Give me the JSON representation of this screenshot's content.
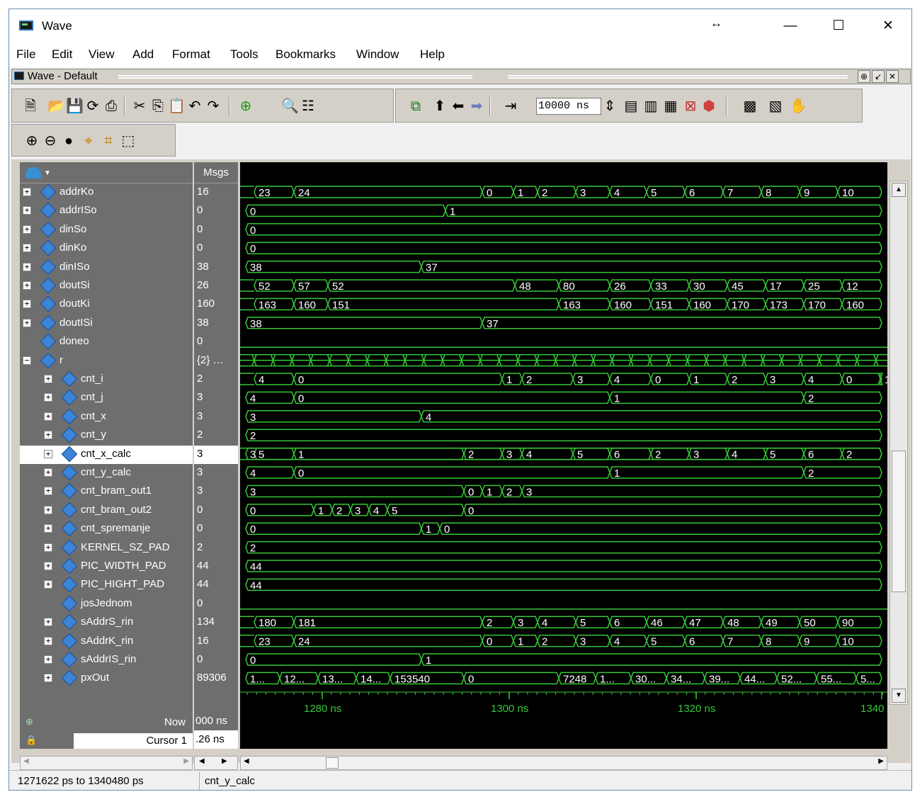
{
  "window": {
    "title": "Wave",
    "resize_indicator": "↔",
    "minimize": "—",
    "maximize": "☐",
    "close": "✕"
  },
  "menu": [
    "File",
    "Edit",
    "View",
    "Add",
    "Format",
    "Tools",
    "Bookmarks",
    "Window",
    "Help"
  ],
  "subwindow": {
    "title": "Wave - Default"
  },
  "toolbar": {
    "time_value": "10000 ns"
  },
  "columns": {
    "msgs": "Msgs"
  },
  "signals": [
    {
      "name": "addrKo",
      "value": "16",
      "level": 0,
      "expand": "+",
      "wave": [
        "23",
        "24",
        "0",
        "1",
        "2",
        "3",
        "4",
        "5",
        "6",
        "7",
        "8",
        "9",
        "10"
      ]
    },
    {
      "name": "addrISo",
      "value": "0",
      "level": 0,
      "expand": "+",
      "wave": [
        "0",
        "1"
      ]
    },
    {
      "name": "dinSo",
      "value": "0",
      "level": 0,
      "expand": "+",
      "wave": [
        "0"
      ]
    },
    {
      "name": "dinKo",
      "value": "0",
      "level": 0,
      "expand": "+",
      "wave": [
        "0"
      ]
    },
    {
      "name": "dinISo",
      "value": "38",
      "level": 0,
      "expand": "+",
      "wave": [
        "38",
        "37"
      ]
    },
    {
      "name": "doutSi",
      "value": "26",
      "level": 0,
      "expand": "+",
      "wave": [
        "52",
        "57",
        "52",
        "48",
        "80",
        "26",
        "33",
        "30",
        "45",
        "17",
        "25",
        "12"
      ]
    },
    {
      "name": "doutKi",
      "value": "160",
      "level": 0,
      "expand": "+",
      "wave": [
        "163",
        "160",
        "151",
        "163",
        "160",
        "151",
        "160",
        "170",
        "173",
        "170",
        "160"
      ]
    },
    {
      "name": "doutISi",
      "value": "38",
      "level": 0,
      "expand": "+",
      "wave": [
        "38",
        "37"
      ]
    },
    {
      "name": "doneo",
      "value": "0",
      "level": 0,
      "expand": "",
      "wave": []
    },
    {
      "name": "r",
      "value": "{2} …",
      "level": 0,
      "expand": "−",
      "wave": []
    },
    {
      "name": "cnt_i",
      "value": "2",
      "level": 1,
      "expand": "+",
      "wave": [
        "4",
        "0",
        "1",
        "2",
        "3",
        "4",
        "0",
        "1",
        "2",
        "3",
        "4",
        "0",
        "1"
      ]
    },
    {
      "name": "cnt_j",
      "value": "3",
      "level": 1,
      "expand": "+",
      "wave": [
        "4",
        "0",
        "1",
        "2"
      ]
    },
    {
      "name": "cnt_x",
      "value": "3",
      "level": 1,
      "expand": "+",
      "wave": [
        "3",
        "4"
      ]
    },
    {
      "name": "cnt_y",
      "value": "2",
      "level": 1,
      "expand": "+",
      "wave": [
        "2"
      ]
    },
    {
      "name": "cnt_x_calc",
      "value": "3",
      "level": 1,
      "expand": "+",
      "selected": true,
      "wave": [
        "5",
        "1",
        "2",
        "3",
        "4",
        "5",
        "6",
        "2",
        "3",
        "4",
        "5",
        "6",
        "2",
        "3"
      ]
    },
    {
      "name": "cnt_y_calc",
      "value": "3",
      "level": 1,
      "expand": "+",
      "wave": [
        "4",
        "0",
        "1",
        "2"
      ]
    },
    {
      "name": "cnt_bram_out1",
      "value": "3",
      "level": 1,
      "expand": "+",
      "wave": [
        "3",
        "0",
        "1",
        "2",
        "3"
      ]
    },
    {
      "name": "cnt_bram_out2",
      "value": "0",
      "level": 1,
      "expand": "+",
      "wave": [
        "0",
        "1",
        "2",
        "3",
        "4",
        "5",
        "0"
      ]
    },
    {
      "name": "cnt_spremanje",
      "value": "0",
      "level": 1,
      "expand": "+",
      "wave": [
        "0",
        "1",
        "0"
      ]
    },
    {
      "name": "KERNEL_SZ_PAD",
      "value": "2",
      "level": 1,
      "expand": "+",
      "wave": [
        "2"
      ]
    },
    {
      "name": "PIC_WIDTH_PAD",
      "value": "44",
      "level": 1,
      "expand": "+",
      "wave": [
        "44"
      ]
    },
    {
      "name": "PIC_HIGHT_PAD",
      "value": "44",
      "level": 1,
      "expand": "+",
      "wave": [
        "44"
      ]
    },
    {
      "name": "josJednom",
      "value": "0",
      "level": 1,
      "expand": "",
      "wave": []
    },
    {
      "name": "sAddrS_rin",
      "value": "134",
      "level": 1,
      "expand": "+",
      "wave": [
        "180",
        "181",
        "2",
        "3",
        "4",
        "5",
        "6",
        "46",
        "47",
        "48",
        "49",
        "50",
        "90"
      ]
    },
    {
      "name": "sAddrK_rin",
      "value": "16",
      "level": 1,
      "expand": "+",
      "wave": [
        "23",
        "24",
        "0",
        "1",
        "2",
        "3",
        "4",
        "5",
        "6",
        "7",
        "8",
        "9",
        "10"
      ]
    },
    {
      "name": "sAddrIS_rin",
      "value": "0",
      "level": 1,
      "expand": "+",
      "wave": [
        "0",
        "1"
      ]
    },
    {
      "name": "pxOut",
      "value": "89306",
      "level": 1,
      "expand": "+",
      "wave": [
        "1...",
        "12...",
        "13...",
        "14...",
        "153540",
        "0",
        "7248",
        "1...",
        "30...",
        "34...",
        "39...",
        "44...",
        "52...",
        "55...",
        "5..."
      ]
    }
  ],
  "timeline": {
    "now_label": "Now",
    "now_value": "000 ns",
    "cursor_label": "Cursor 1",
    "cursor_value": ".26 ns",
    "ticks": [
      "1280 ns",
      "1300 ns",
      "1320 ns",
      "1340"
    ]
  },
  "status": {
    "range": "1271622 ps to 1340480 ps",
    "selected": "cnt_y_calc"
  }
}
